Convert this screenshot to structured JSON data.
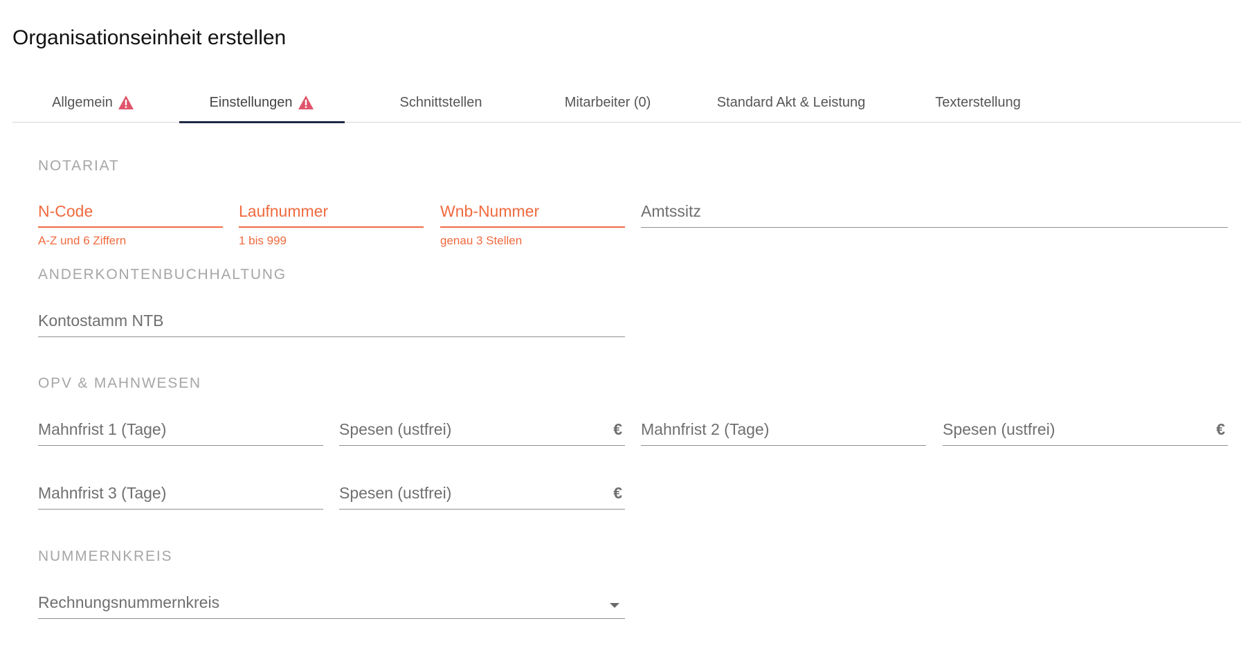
{
  "page": {
    "title": "Organisationseinheit erstellen"
  },
  "tabs": [
    {
      "label": "Allgemein",
      "warning": true
    },
    {
      "label": "Einstellungen",
      "warning": true,
      "active": true
    },
    {
      "label": "Schnittstellen",
      "warning": false
    },
    {
      "label": "Mitarbeiter (0)",
      "warning": false
    },
    {
      "label": "Standard Akt & Leistung",
      "warning": false
    },
    {
      "label": "Texterstellung",
      "warning": false
    }
  ],
  "colors": {
    "error": "#f06a3e",
    "warning_icon": "#e0556b",
    "tab_indicator": "#1f2a44"
  },
  "sections": {
    "notariat": {
      "title": "NOTARIAT",
      "n_code": {
        "label": "N-Code",
        "hint": "A-Z und 6 Ziffern",
        "value": ""
      },
      "laufnummer": {
        "label": "Laufnummer",
        "hint": "1 bis 999",
        "value": ""
      },
      "wnb_nummer": {
        "label": "Wnb-Nummer",
        "hint": "genau 3 Stellen",
        "value": ""
      },
      "amtssitz": {
        "label": "Amtssitz",
        "value": ""
      }
    },
    "anderkonten": {
      "title": "ANDERKONTENBUCHHALTUNG",
      "kontostamm": {
        "label": "Kontostamm NTB",
        "value": ""
      }
    },
    "opv": {
      "title": "OPV & MAHNWESEN",
      "mahnfrist1": {
        "label": "Mahnfrist 1 (Tage)"
      },
      "spesen1": {
        "label": "Spesen (ustfrei)",
        "suffix": "€"
      },
      "mahnfrist2": {
        "label": "Mahnfrist 2 (Tage)"
      },
      "spesen2": {
        "label": "Spesen (ustfrei)",
        "suffix": "€"
      },
      "mahnfrist3": {
        "label": "Mahnfrist 3 (Tage)"
      },
      "spesen3": {
        "label": "Spesen (ustfrei)",
        "suffix": "€"
      }
    },
    "nummernkreis": {
      "title": "NUMMERNKREIS",
      "rechnungsnummernkreis": {
        "label": "Rechnungsnummernkreis",
        "selected": ""
      }
    }
  }
}
